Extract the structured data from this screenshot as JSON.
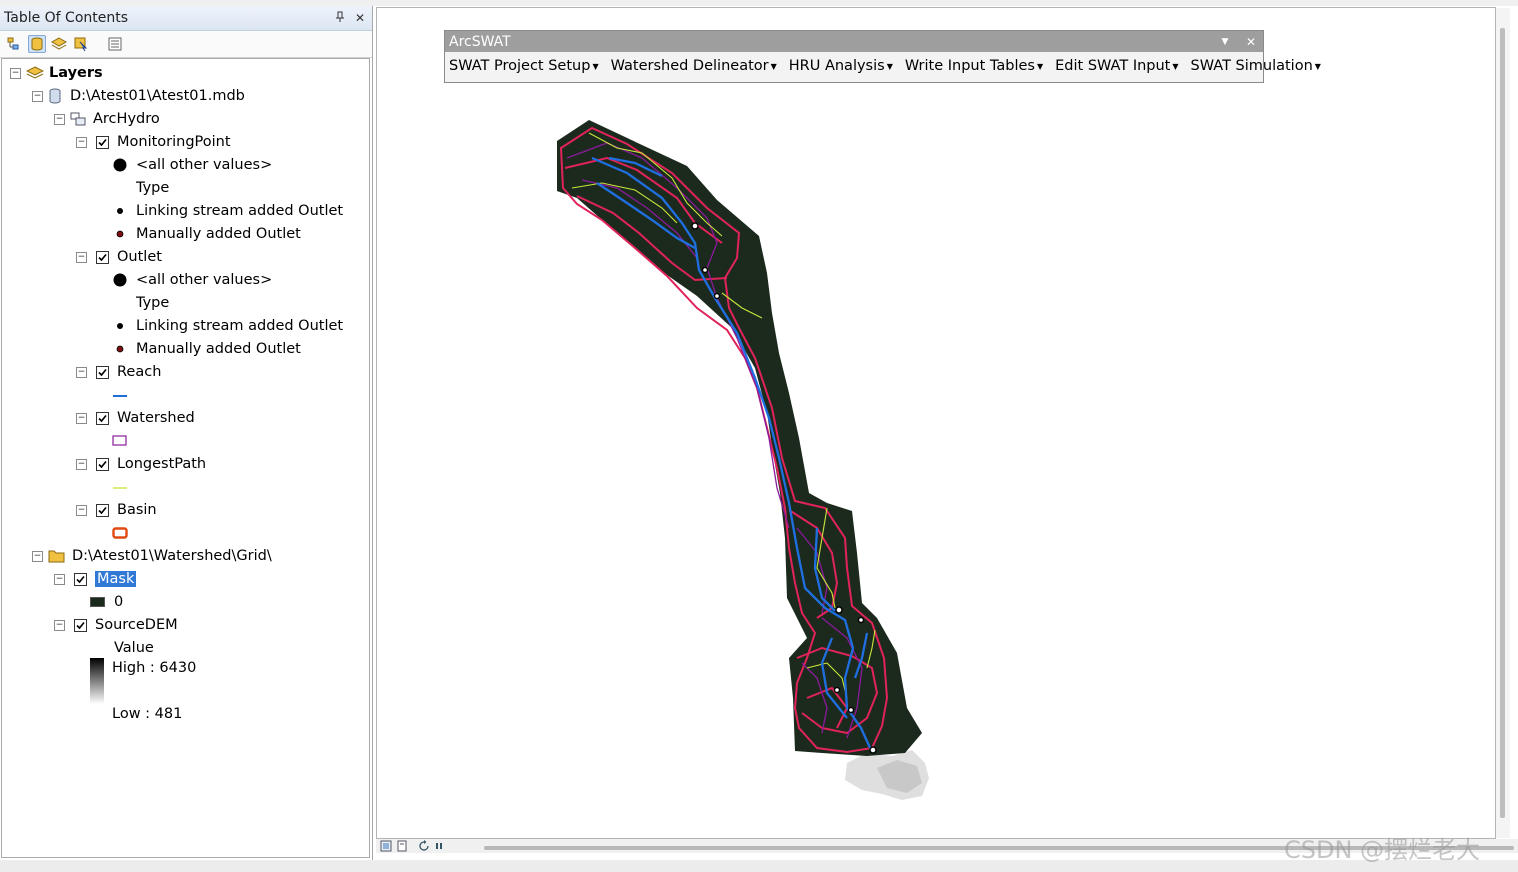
{
  "toc": {
    "title": "Table Of Contents",
    "pin_glyph": "⌥",
    "close_glyph": "✕",
    "tree": {
      "root": "Layers",
      "db_path": "D:\\Atest01\\Atest01.mdb",
      "dataset": "ArcHydro",
      "monitoring": {
        "name": "MonitoringPoint",
        "all_other": "<all other values>",
        "type_heading": "Type",
        "linking": "Linking stream added Outlet",
        "manual": "Manually added Outlet"
      },
      "outlet": {
        "name": "Outlet",
        "all_other": "<all other values>",
        "type_heading": "Type",
        "linking": "Linking stream added Outlet",
        "manual": "Manually added Outlet"
      },
      "reach": "Reach",
      "watershed": "Watershed",
      "longestpath": "LongestPath",
      "basin": "Basin",
      "grid_path": "D:\\Atest01\\Watershed\\Grid\\",
      "mask": "Mask",
      "mask_value": "0",
      "sourcedem": "SourceDEM",
      "value_heading": "Value",
      "high": "High : 6430",
      "low": "Low : 481"
    }
  },
  "arcswat": {
    "title": "ArcSWAT",
    "menus": [
      "SWAT Project Setup",
      "Watershed Delineator",
      "HRU Analysis",
      "Write Input Tables",
      "Edit SWAT Input",
      "SWAT Simulation"
    ]
  },
  "colors": {
    "reach": "#1f6fe0",
    "watershed": "#8a1a9a",
    "longestpath": "#c8e63a",
    "basin": "#e0235a",
    "mask": "#1c2a1e",
    "selection": "#3079d6"
  },
  "watermark": "CSDN @摆烂老大"
}
